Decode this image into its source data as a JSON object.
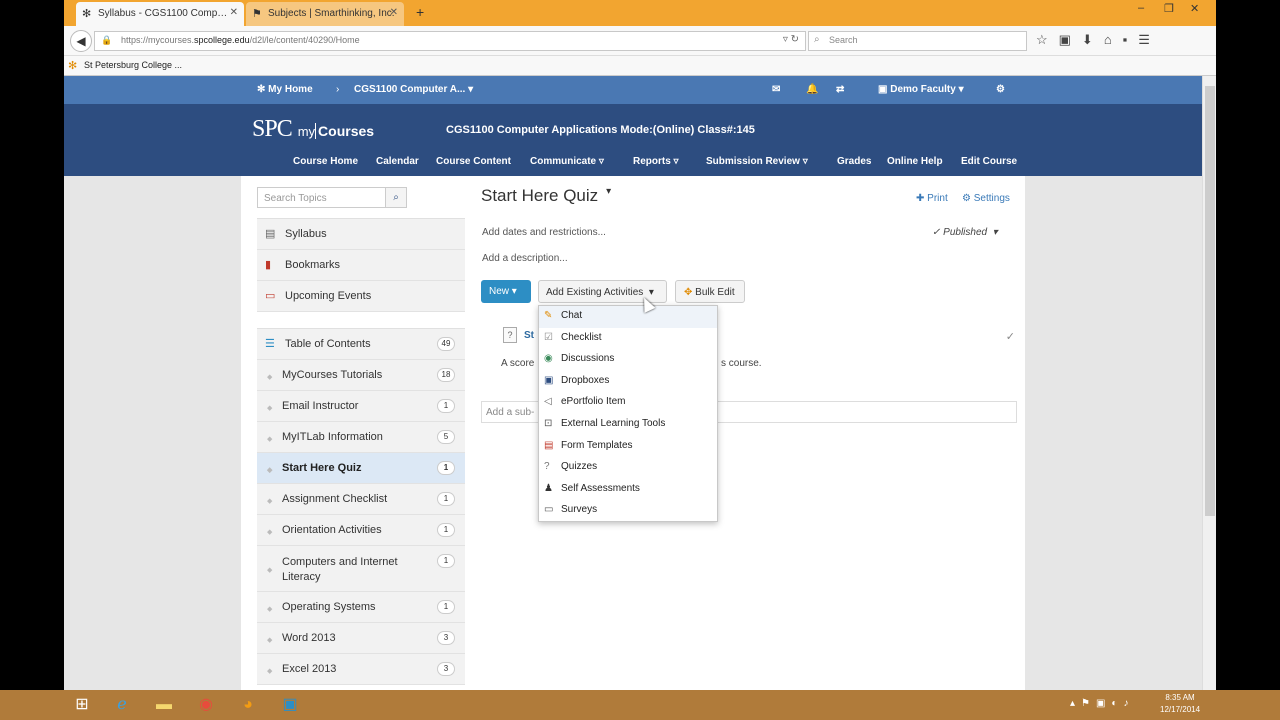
{
  "browser": {
    "tabs": [
      {
        "label": "Syllabus - CGS1100 Comp…",
        "active": true
      },
      {
        "label": "Subjects | Smarthinking, Inc.",
        "active": false
      }
    ],
    "url_prefix": "https://mycourses.",
    "url_domain": "spcollege.edu",
    "url_path": "/d2l/le/content/40290/Home",
    "search_placeholder": "Search",
    "bookmark": "St Petersburg College ..."
  },
  "d2l": {
    "my_home": "My Home",
    "course_crumb": "CGS1100 Computer A...",
    "user": "Demo Faculty",
    "logo_spc": "SPC",
    "logo_my": "my",
    "logo_courses": "Courses",
    "course_title": "CGS1100 Computer Applications Mode:(Online) Class#:145",
    "nav": [
      "Course Home",
      "Calendar",
      "Course Content",
      "Communicate ▿",
      "Reports ▿",
      "Submission Review ▿",
      "Grades",
      "Online Help",
      "Edit Course"
    ]
  },
  "sidebar": {
    "search_placeholder": "Search Topics",
    "tools": [
      {
        "label": "Syllabus",
        "icon": "syllabus-icon"
      },
      {
        "label": "Bookmarks",
        "icon": "bookmark-icon"
      },
      {
        "label": "Upcoming Events",
        "icon": "calendar-icon"
      }
    ],
    "toc_header": {
      "label": "Table of Contents",
      "count": "49"
    },
    "modules": [
      {
        "label": "MyCourses Tutorials",
        "count": "18"
      },
      {
        "label": "Email Instructor",
        "count": "1"
      },
      {
        "label": "MyITLab Information",
        "count": "5"
      },
      {
        "label": "Start Here Quiz",
        "count": "1"
      },
      {
        "label": "Assignment Checklist",
        "count": "1"
      },
      {
        "label": "Orientation Activities",
        "count": "1"
      },
      {
        "label": "Computers and Internet Literacy",
        "count": "1"
      },
      {
        "label": "Operating Systems",
        "count": "1"
      },
      {
        "label": "Word 2013",
        "count": "3"
      },
      {
        "label": "Excel 2013",
        "count": "3"
      }
    ]
  },
  "main": {
    "title": "Start Here Quiz",
    "print": "Print",
    "settings": "Settings",
    "add_dates": "Add dates and restrictions...",
    "add_description": "Add a description...",
    "published": "✓ Published",
    "new_button": "New",
    "add_existing": "Add Existing Activities",
    "bulk_edit": "Bulk Edit",
    "topic_name": "St",
    "topic_desc_a": "A score",
    "topic_desc_b": "s course.",
    "sub_placeholder": "Add a sub-",
    "dropdown": [
      {
        "label": "Chat",
        "icon": "chat-icon"
      },
      {
        "label": "Checklist",
        "icon": "checklist-icon"
      },
      {
        "label": "Discussions",
        "icon": "discussions-icon"
      },
      {
        "label": "Dropboxes",
        "icon": "dropbox-icon"
      },
      {
        "label": "ePortfolio Item",
        "icon": "eportfolio-icon"
      },
      {
        "label": "External Learning Tools",
        "icon": "external-tool-icon"
      },
      {
        "label": "Form Templates",
        "icon": "form-template-icon"
      },
      {
        "label": "Quizzes",
        "icon": "quiz-icon"
      },
      {
        "label": "Self Assessments",
        "icon": "self-assessment-icon"
      },
      {
        "label": "Surveys",
        "icon": "survey-icon"
      }
    ]
  },
  "taskbar": {
    "time": "8:35 AM",
    "date": "12/17/2014"
  }
}
